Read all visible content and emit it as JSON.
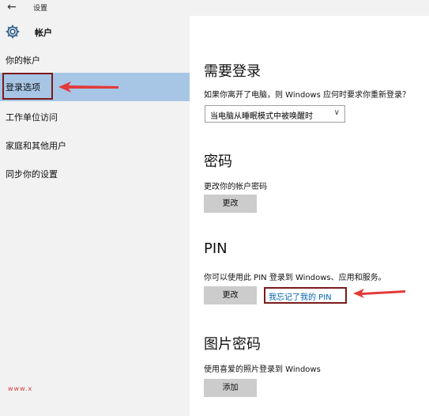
{
  "window": {
    "back_glyph": "←",
    "title": "设置"
  },
  "sidebar": {
    "section_icon": "gear-icon",
    "section_title": "帐户",
    "items": [
      {
        "label": "你的帐户"
      },
      {
        "label": "登录选项",
        "selected": true
      },
      {
        "label": "工作单位访问"
      },
      {
        "label": "家庭和其他用户"
      },
      {
        "label": "同步你的设置"
      }
    ]
  },
  "main": {
    "require_signin": {
      "heading": "需要登录",
      "description": "如果你离开了电脑，则 Windows 应何时要求你重新登录？",
      "dropdown_value": "当电脑从睡眠模式中被唤醒时"
    },
    "password": {
      "heading": "密码",
      "description": "更改你的帐户密码",
      "button": "更改"
    },
    "pin": {
      "heading": "PIN",
      "description": "你可以使用此 PIN 登录到 Windows、应用和服务。",
      "button": "更改",
      "forgot_link": "我忘记了我的 PIN"
    },
    "picture_password": {
      "heading": "图片密码",
      "description": "使用喜爱的照片登录到 Windows",
      "button": "添加"
    }
  },
  "watermark": "www.x",
  "colors": {
    "sidebar_bg": "#f2f2f2",
    "selected_bg": "#a7c6e6",
    "button_bg": "#cccccc",
    "link": "#0063b1",
    "annotation": "#e23b3b",
    "frame": "#7a1b1b"
  }
}
